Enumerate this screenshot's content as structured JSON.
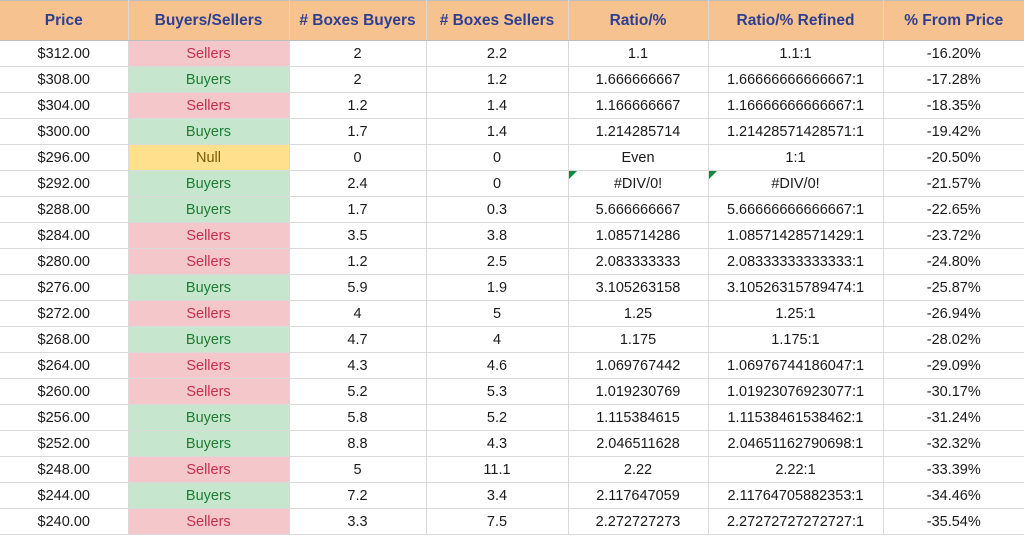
{
  "headers": {
    "price": "Price",
    "bs": "Buyers/Sellers",
    "bbuy": "# Boxes Buyers",
    "bsell": "# Boxes Sellers",
    "ratio": "Ratio/%",
    "refined": "Ratio/% Refined",
    "pct": "% From Price"
  },
  "rows": [
    {
      "price": "$312.00",
      "bs": "Sellers",
      "bs_kind": "sellers",
      "bbuy": "2",
      "bsell": "2.2",
      "ratio": "1.1",
      "refined": "1.1:1",
      "pct": "-16.20%",
      "flag": false
    },
    {
      "price": "$308.00",
      "bs": "Buyers",
      "bs_kind": "buyers",
      "bbuy": "2",
      "bsell": "1.2",
      "ratio": "1.666666667",
      "refined": "1.66666666666667:1",
      "pct": "-17.28%",
      "flag": false
    },
    {
      "price": "$304.00",
      "bs": "Sellers",
      "bs_kind": "sellers",
      "bbuy": "1.2",
      "bsell": "1.4",
      "ratio": "1.166666667",
      "refined": "1.16666666666667:1",
      "pct": "-18.35%",
      "flag": false
    },
    {
      "price": "$300.00",
      "bs": "Buyers",
      "bs_kind": "buyers",
      "bbuy": "1.7",
      "bsell": "1.4",
      "ratio": "1.214285714",
      "refined": "1.21428571428571:1",
      "pct": "-19.42%",
      "flag": false
    },
    {
      "price": "$296.00",
      "bs": "Null",
      "bs_kind": "null",
      "bbuy": "0",
      "bsell": "0",
      "ratio": "Even",
      "refined": "1:1",
      "pct": "-20.50%",
      "flag": false
    },
    {
      "price": "$292.00",
      "bs": "Buyers",
      "bs_kind": "buyers",
      "bbuy": "2.4",
      "bsell": "0",
      "ratio": "#DIV/0!",
      "refined": "#DIV/0!",
      "pct": "-21.57%",
      "flag": true
    },
    {
      "price": "$288.00",
      "bs": "Buyers",
      "bs_kind": "buyers",
      "bbuy": "1.7",
      "bsell": "0.3",
      "ratio": "5.666666667",
      "refined": "5.66666666666667:1",
      "pct": "-22.65%",
      "flag": false
    },
    {
      "price": "$284.00",
      "bs": "Sellers",
      "bs_kind": "sellers",
      "bbuy": "3.5",
      "bsell": "3.8",
      "ratio": "1.085714286",
      "refined": "1.08571428571429:1",
      "pct": "-23.72%",
      "flag": false
    },
    {
      "price": "$280.00",
      "bs": "Sellers",
      "bs_kind": "sellers",
      "bbuy": "1.2",
      "bsell": "2.5",
      "ratio": "2.083333333",
      "refined": "2.08333333333333:1",
      "pct": "-24.80%",
      "flag": false
    },
    {
      "price": "$276.00",
      "bs": "Buyers",
      "bs_kind": "buyers",
      "bbuy": "5.9",
      "bsell": "1.9",
      "ratio": "3.105263158",
      "refined": "3.10526315789474:1",
      "pct": "-25.87%",
      "flag": false
    },
    {
      "price": "$272.00",
      "bs": "Sellers",
      "bs_kind": "sellers",
      "bbuy": "4",
      "bsell": "5",
      "ratio": "1.25",
      "refined": "1.25:1",
      "pct": "-26.94%",
      "flag": false
    },
    {
      "price": "$268.00",
      "bs": "Buyers",
      "bs_kind": "buyers",
      "bbuy": "4.7",
      "bsell": "4",
      "ratio": "1.175",
      "refined": "1.175:1",
      "pct": "-28.02%",
      "flag": false
    },
    {
      "price": "$264.00",
      "bs": "Sellers",
      "bs_kind": "sellers",
      "bbuy": "4.3",
      "bsell": "4.6",
      "ratio": "1.069767442",
      "refined": "1.06976744186047:1",
      "pct": "-29.09%",
      "flag": false
    },
    {
      "price": "$260.00",
      "bs": "Sellers",
      "bs_kind": "sellers",
      "bbuy": "5.2",
      "bsell": "5.3",
      "ratio": "1.019230769",
      "refined": "1.01923076923077:1",
      "pct": "-30.17%",
      "flag": false
    },
    {
      "price": "$256.00",
      "bs": "Buyers",
      "bs_kind": "buyers",
      "bbuy": "5.8",
      "bsell": "5.2",
      "ratio": "1.115384615",
      "refined": "1.11538461538462:1",
      "pct": "-31.24%",
      "flag": false
    },
    {
      "price": "$252.00",
      "bs": "Buyers",
      "bs_kind": "buyers",
      "bbuy": "8.8",
      "bsell": "4.3",
      "ratio": "2.046511628",
      "refined": "2.04651162790698:1",
      "pct": "-32.32%",
      "flag": false
    },
    {
      "price": "$248.00",
      "bs": "Sellers",
      "bs_kind": "sellers",
      "bbuy": "5",
      "bsell": "11.1",
      "ratio": "2.22",
      "refined": "2.22:1",
      "pct": "-33.39%",
      "flag": false
    },
    {
      "price": "$244.00",
      "bs": "Buyers",
      "bs_kind": "buyers",
      "bbuy": "7.2",
      "bsell": "3.4",
      "ratio": "2.117647059",
      "refined": "2.11764705882353:1",
      "pct": "-34.46%",
      "flag": false
    },
    {
      "price": "$240.00",
      "bs": "Sellers",
      "bs_kind": "sellers",
      "bbuy": "3.3",
      "bsell": "7.5",
      "ratio": "2.272727273",
      "refined": "2.27272727272727:1",
      "pct": "-35.54%",
      "flag": false
    }
  ]
}
